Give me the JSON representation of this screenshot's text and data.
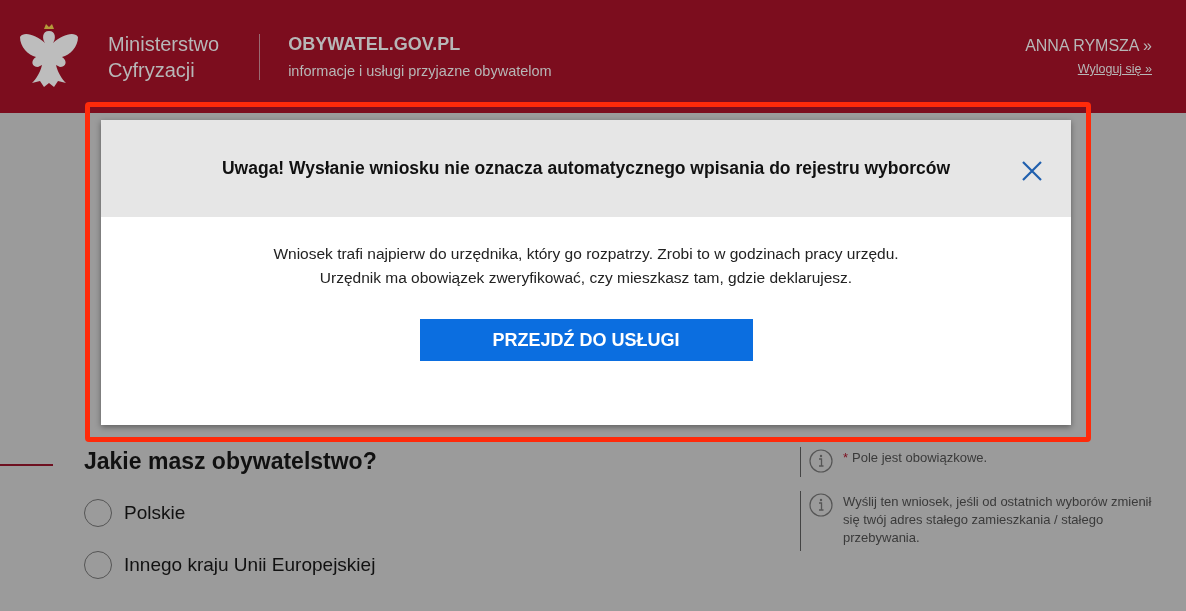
{
  "header": {
    "ministry_name": [
      "Ministerstwo",
      "Cyfryzacji"
    ],
    "site_title": "OBYWATEL.GOV.PL",
    "site_tagline": "informacje i usługi przyjazne obywatelom",
    "user_name": "ANNA RYMSZA »",
    "logout_link": "Wyloguj się »"
  },
  "page": {
    "question": "Jakie masz obywatelstwo?",
    "options": [
      {
        "label": "Polskie",
        "selected": false
      },
      {
        "label": "Innego kraju Unii Europejskiej",
        "selected": false
      }
    ],
    "notes": [
      {
        "required_mark": "*",
        "text": "Pole jest obowiązkowe."
      },
      {
        "text": "Wyślij ten wniosek, jeśli od ostatnich wyborów zmienił się twój adres stałego zamieszkania / stałego przebywania."
      }
    ]
  },
  "modal": {
    "title": "Uwaga! Wysłanie wniosku nie oznacza automatycznego wpisania do rejestru wyborców",
    "body_lines": [
      "Wniosek trafi najpierw do urzędnika, który go rozpatrzy. Zrobi to w godzinach pracy urzędu.",
      "Urzędnik ma obowiązek zweryfikować, czy mieszkasz tam, gdzie deklarujesz."
    ],
    "button": "PRZEJDŹ DO USŁUGI"
  }
}
